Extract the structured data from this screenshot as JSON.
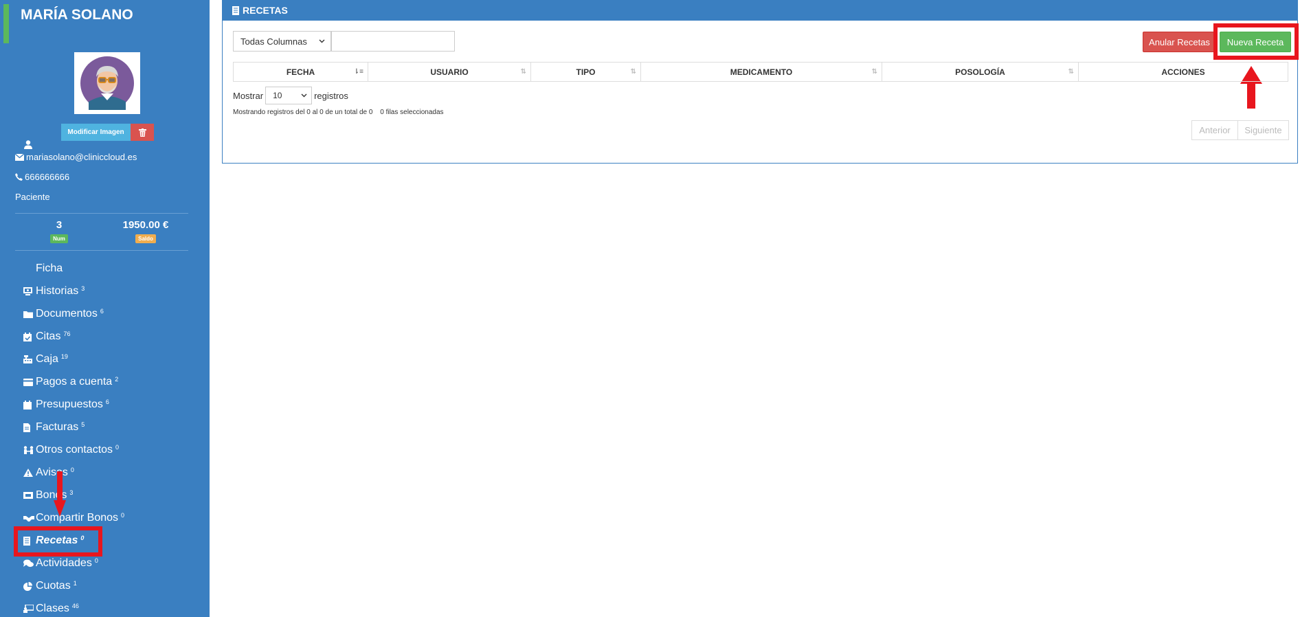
{
  "patient": {
    "name": "MARÍA SOLANO",
    "email": "mariasolano@cliniccloud.es",
    "phone": "666666666",
    "role": "Paciente",
    "modify_image_label": "Modificar Imagen"
  },
  "stats": {
    "num_value": "3",
    "num_label": "Num",
    "saldo_value": "1950.00 €",
    "saldo_label": "Saldo"
  },
  "nav": [
    {
      "label": "Ficha",
      "count": "",
      "icon": "none"
    },
    {
      "label": "Historias",
      "count": "3",
      "icon": "history-icon"
    },
    {
      "label": "Documentos",
      "count": "6",
      "icon": "folder-icon"
    },
    {
      "label": "Citas",
      "count": "76",
      "icon": "calendar-check-icon"
    },
    {
      "label": "Caja",
      "count": "19",
      "icon": "cash-register-icon"
    },
    {
      "label": "Pagos a cuenta",
      "count": "2",
      "icon": "wallet-icon"
    },
    {
      "label": "Presupuestos",
      "count": "6",
      "icon": "calendar-icon"
    },
    {
      "label": "Facturas",
      "count": "5",
      "icon": "invoice-icon"
    },
    {
      "label": "Otros contactos",
      "count": "0",
      "icon": "contacts-icon"
    },
    {
      "label": "Avisos",
      "count": "0",
      "icon": "warning-icon"
    },
    {
      "label": "Bonos",
      "count": "3",
      "icon": "ticket-icon"
    },
    {
      "label": "Compartir Bonos",
      "count": "0",
      "icon": "handshake-icon"
    },
    {
      "label": "Recetas",
      "count": "0",
      "icon": "prescription-icon"
    },
    {
      "label": "Actividades",
      "count": "0",
      "icon": "comments-icon"
    },
    {
      "label": "Cuotas",
      "count": "1",
      "icon": "pie-chart-icon"
    },
    {
      "label": "Clases",
      "count": "46",
      "icon": "classes-icon"
    }
  ],
  "panel": {
    "title": "RECETAS",
    "column_filter": "Todas Columnas",
    "search_value": "",
    "anular_label": "Anular Recetas",
    "nueva_label": "Nueva Receta",
    "columns": [
      "FECHA",
      "USUARIO",
      "TIPO",
      "MEDICAMENTO",
      "POSOLOGÍA",
      "ACCIONES"
    ],
    "length_prefix": "Mostrar",
    "length_value": "10",
    "length_suffix": "registros",
    "info": "Mostrando registros del 0 al 0 de un total de 0",
    "selected_info": "0 filas seleccionadas",
    "prev_label": "Anterior",
    "next_label": "Siguiente"
  },
  "colors": {
    "sidebar": "#3a7fc1",
    "accent_green": "#5cb85c",
    "danger_red": "#d9534f",
    "highlight": "#e8161e"
  }
}
